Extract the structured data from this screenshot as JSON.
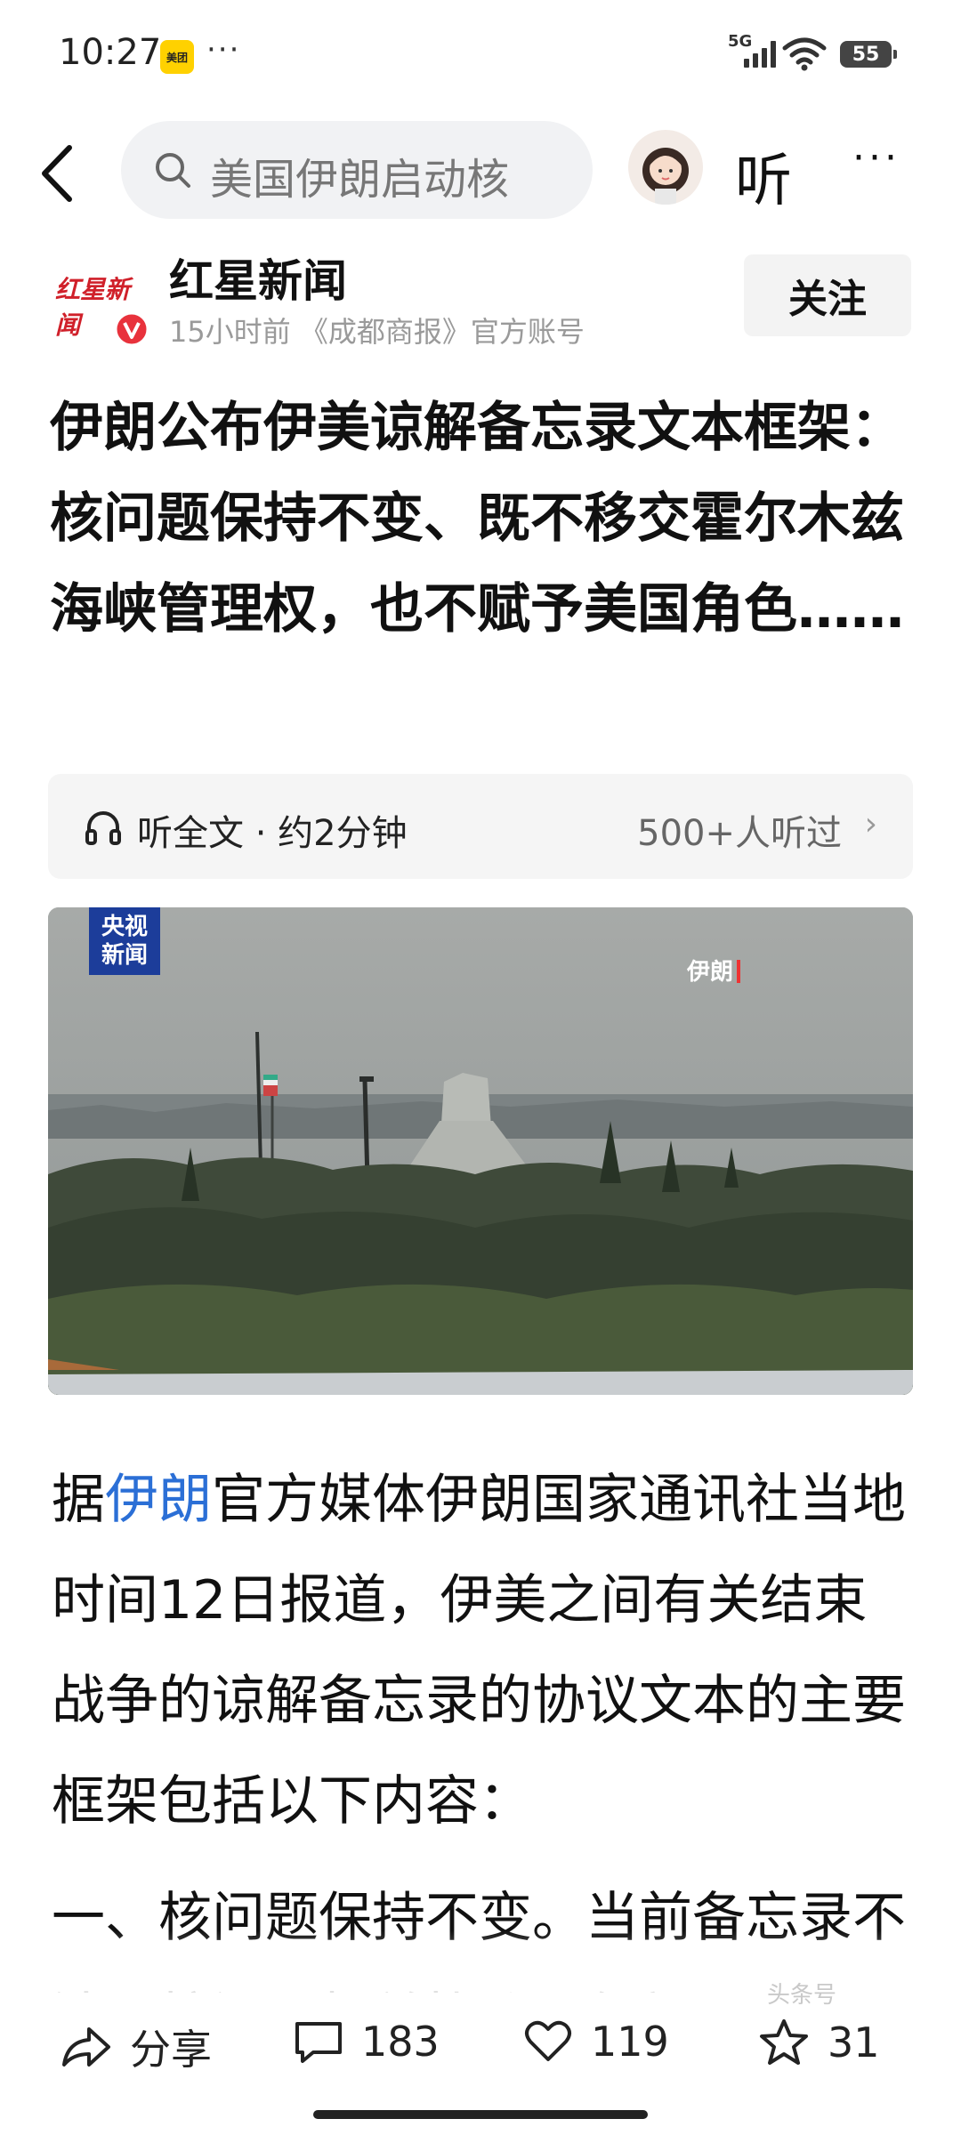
{
  "status": {
    "time": "10:27",
    "app_badge": "美团",
    "more_dots": "···",
    "network": "5G",
    "battery": "55"
  },
  "topbar": {
    "search_placeholder": "美国伊朗启动核",
    "listen_label": "听",
    "more_label": "···"
  },
  "author": {
    "logo_text": "红星新闻",
    "name": "红星新闻",
    "meta": "15小时前 《成都商报》官方账号",
    "follow_label": "关注"
  },
  "article": {
    "title": "伊朗公布伊美谅解备忘录文本框架：核问题保持不变、既不移交霍尔木兹海峡管理权，也不赋予美国角色……",
    "audio_label": "听全文 · 约2分钟",
    "audio_count": "500+人听过",
    "image_logo_line1": "央视",
    "image_logo_line2": "新闻",
    "image_location": "伊朗",
    "para1_prefix": "据",
    "para1_link": "伊朗",
    "para1_rest": "官方媒体伊朗国家通讯社当地时间12日报道，伊美之间有关结束战争的谅解备忘录的协议文本的主要框架包括以下内容：",
    "para2": "一、核问题保持不变。当前备忘录不涉及核问题相关协议，伊朗"
  },
  "actions": {
    "share_label": "分享",
    "comments": "183",
    "likes": "119",
    "favorites": "31"
  },
  "watermark": "头条号"
}
